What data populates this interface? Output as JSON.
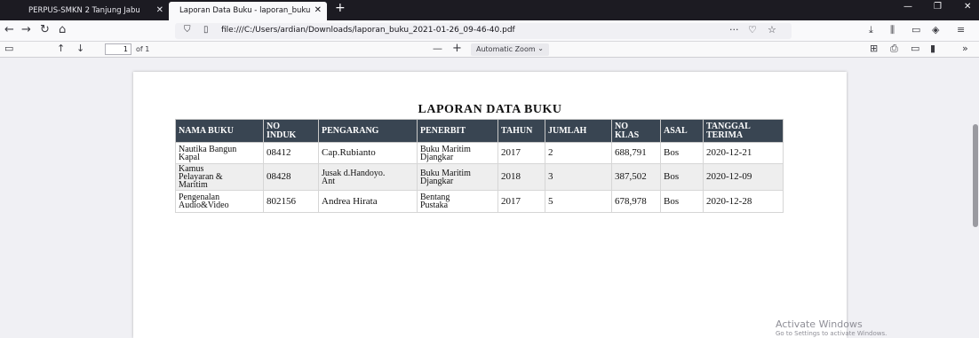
{
  "browser": {
    "tabs": [
      {
        "label": "PERPUS-SMKN 2 Tanjung Jabu",
        "active": false
      },
      {
        "label": "Laporan Data Buku - laporan_buku",
        "active": true
      }
    ],
    "new_tab_label": "+",
    "url": "file:///C:/Users/ardian/Downloads/laporan_buku_2021-01-26_09-46-40.pdf",
    "url_actions": "···"
  },
  "pdf_toolbar": {
    "page_number": "1",
    "page_count_label": "of 1",
    "zoom_label": "Automatic Zoom"
  },
  "document": {
    "title": "LAPORAN DATA BUKU",
    "headers": [
      [
        "NAMA BUKU"
      ],
      [
        "NO",
        "INDUK"
      ],
      [
        "PENGARANG"
      ],
      [
        "PENERBIT"
      ],
      [
        "TAHUN"
      ],
      [
        "JUMLAH"
      ],
      [
        "NO",
        "KLAS"
      ],
      [
        "ASAL"
      ],
      [
        "TANGGAL",
        "TERIMA"
      ]
    ],
    "rows": [
      [
        [
          "Nautika Bangun",
          "Kapal"
        ],
        [
          "08412"
        ],
        [
          "Cap.Rubianto"
        ],
        [
          "Buku Maritim",
          "Djangkar"
        ],
        [
          "2017"
        ],
        [
          "2"
        ],
        [
          "688,791"
        ],
        [
          "Bos"
        ],
        [
          "2020-12-21"
        ]
      ],
      [
        [
          "Kamus",
          "Pelayaran &",
          "Maritim"
        ],
        [
          "08428"
        ],
        [
          "Jusak d.Handoyo.",
          "Ant"
        ],
        [
          "Buku Maritim",
          "Djangkar"
        ],
        [
          "2018"
        ],
        [
          "3"
        ],
        [
          "387,502"
        ],
        [
          "Bos"
        ],
        [
          "2020-12-09"
        ]
      ],
      [
        [
          "Pengenalan",
          "Audio&Video"
        ],
        [
          "802156"
        ],
        [
          "Andrea Hirata"
        ],
        [
          "Bentang",
          "Pustaka"
        ],
        [
          "2017"
        ],
        [
          "5"
        ],
        [
          "678,978"
        ],
        [
          "Bos"
        ],
        [
          "2020-12-28"
        ]
      ]
    ]
  },
  "watermark": {
    "line1": "Activate Windows",
    "line2": "Go to Settings to activate Windows."
  },
  "colors": {
    "header_bg": "#394552",
    "tabstrip_bg": "#1c1b22"
  }
}
